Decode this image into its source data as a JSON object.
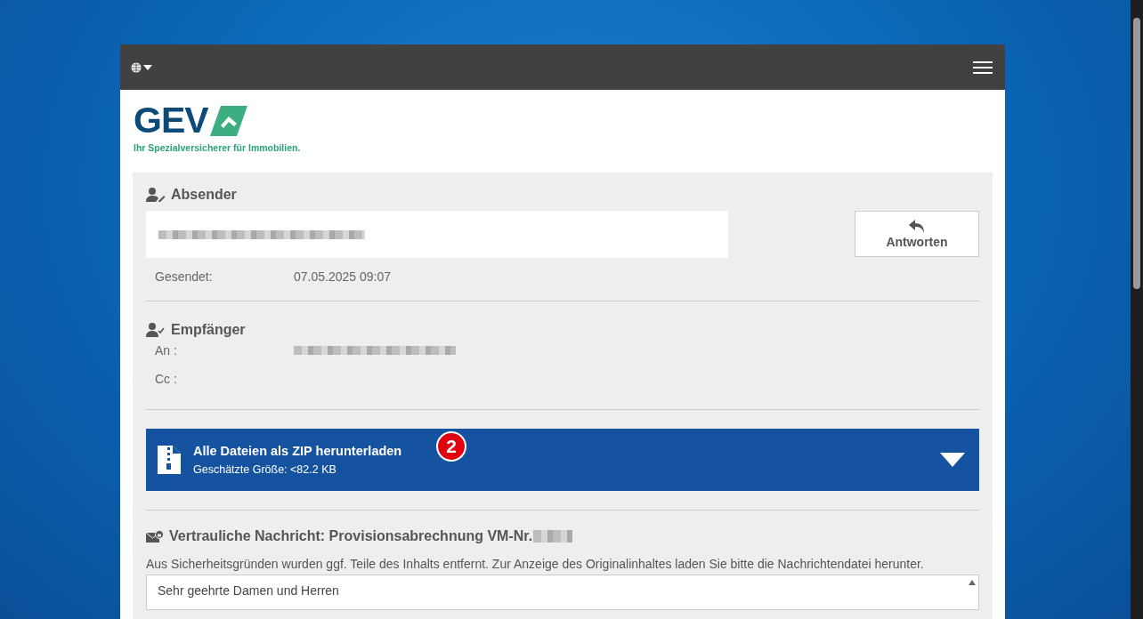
{
  "logo": {
    "wordmark": "GEV",
    "tagline": "Ihr Spezialversicherer für Immobilien."
  },
  "sender": {
    "heading": "Absender",
    "sent_label": "Gesendet:",
    "sent_value": "07.05.2025 09:07",
    "reply_button": "Antworten"
  },
  "recipients": {
    "heading": "Empfänger",
    "to_label": "An :",
    "cc_label": "Cc :"
  },
  "download": {
    "title": "Alle Dateien als ZIP herunterladen",
    "size": "Geschätzte Größe: <82.2 KB",
    "badge": "2",
    "expanded": false
  },
  "message": {
    "heading": "Vertrauliche Nachricht: Provisionsabrechnung VM-Nr.",
    "notice": "Aus Sicherheitsgründen wurden ggf. Teile des Inhalts entfernt. Zur Anzeige des Originalinhaltes laden Sie bitte die Nachrichtendatei herunter.",
    "body_start": "Sehr geehrte Damen und Herren"
  }
}
